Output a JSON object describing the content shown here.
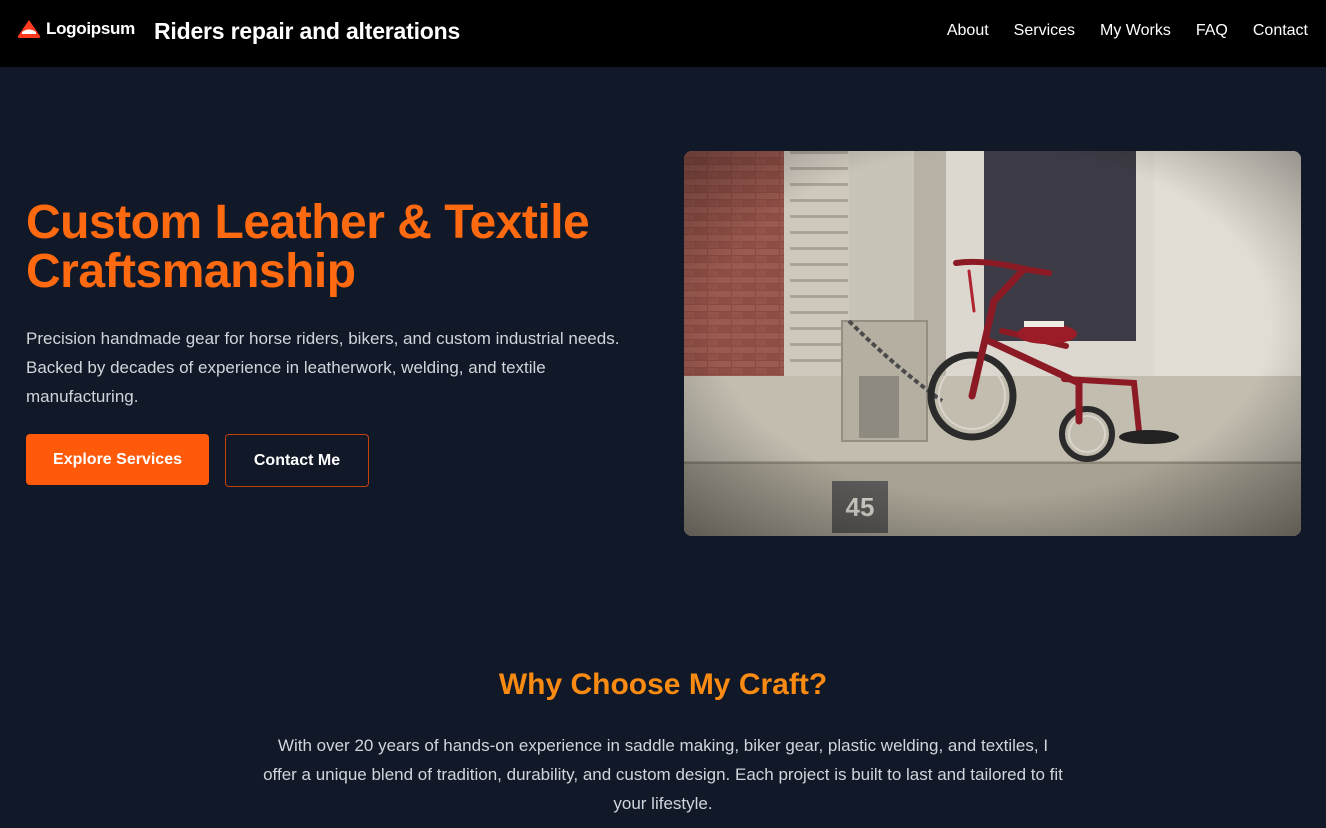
{
  "navbar": {
    "logo_text": "Logoipsum",
    "site_title": "Riders repair and alterations",
    "links": [
      "About",
      "Services",
      "My Works",
      "FAQ",
      "Contact"
    ]
  },
  "hero": {
    "title": "Custom Leather & Textile Craftsmanship",
    "description": "Precision handmade gear for horse riders, bikers, and custom industrial needs. Backed by decades of experience in leatherwork, welding, and textile manufacturing.",
    "primary_button": "Explore Services",
    "secondary_button": "Contact Me",
    "image_number": "45"
  },
  "why": {
    "title": "Why Choose My Craft?",
    "text": "With over 20 years of hands-on experience in saddle making, biker gear, plastic welding, and textiles, I offer a unique blend of tradition, durability, and custom design. Each project is built to last and tailored to fit your lifestyle."
  },
  "colors": {
    "navbar_bg": "#000000",
    "page_bg": "#111827",
    "accent": "#ff6a10",
    "button_primary": "#ff5a0a",
    "section_title": "#f98a12"
  }
}
